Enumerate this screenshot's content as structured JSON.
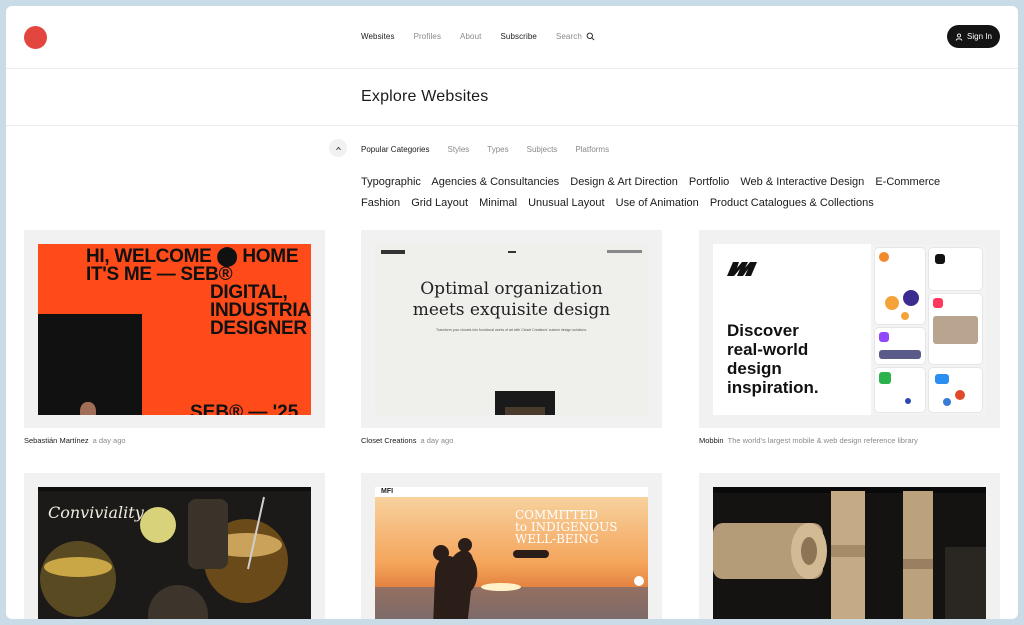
{
  "header": {
    "nav": [
      "Websites",
      "Profiles",
      "About",
      "Subscribe",
      "Search"
    ],
    "sign_in": "Sign In"
  },
  "page_title": "Explore Websites",
  "category_tabs": [
    "Popular Categories",
    "Styles",
    "Types",
    "Subjects",
    "Platforms"
  ],
  "categories": [
    "Typographic",
    "Agencies & Consultancies",
    "Design & Art Direction",
    "Portfolio",
    "Web & Interactive Design",
    "E-Commerce",
    "Fashion",
    "Grid Layout",
    "Minimal",
    "Unusual Layout",
    "Use of Animation",
    "Product Catalogues & Collections"
  ],
  "cards": [
    {
      "name": "Sebastián Martínez",
      "meta": "a day ago",
      "thumb_lines": [
        "HI, WELCOME ⬤ HOME",
        "IT'S ME — SEB®",
        "DIGITAL,",
        "INDUSTRIAL,",
        "DESIGNER"
      ],
      "thumb_bottom": "SEB® — '25"
    },
    {
      "name": "Closet Creations",
      "meta": "a day ago",
      "thumb_lines": [
        "Optimal organization",
        "meets exquisite design"
      ],
      "thumb_sub": "Transform your closets into functional works of art with Closet Creations' custom design solutions."
    },
    {
      "name": "Mobbin",
      "meta": "The world's largest mobile & web design reference library",
      "thumb_lines": [
        "Discover",
        "real-world",
        "design",
        "inspiration."
      ]
    },
    {
      "name": "",
      "meta": "",
      "thumb_lines": [
        "Conviviality"
      ]
    },
    {
      "name": "",
      "meta": "",
      "thumb_lines": [
        "COMMITTED",
        "to INDIGENOUS",
        "WELL-BEING"
      ],
      "thumb_logo": "MFI"
    },
    {
      "name": "",
      "meta": "",
      "thumb_lines": []
    }
  ],
  "colors": {
    "logo": "#e2463e",
    "sign_in_bg": "#141414",
    "seb_orange": "#ff4a1a"
  }
}
